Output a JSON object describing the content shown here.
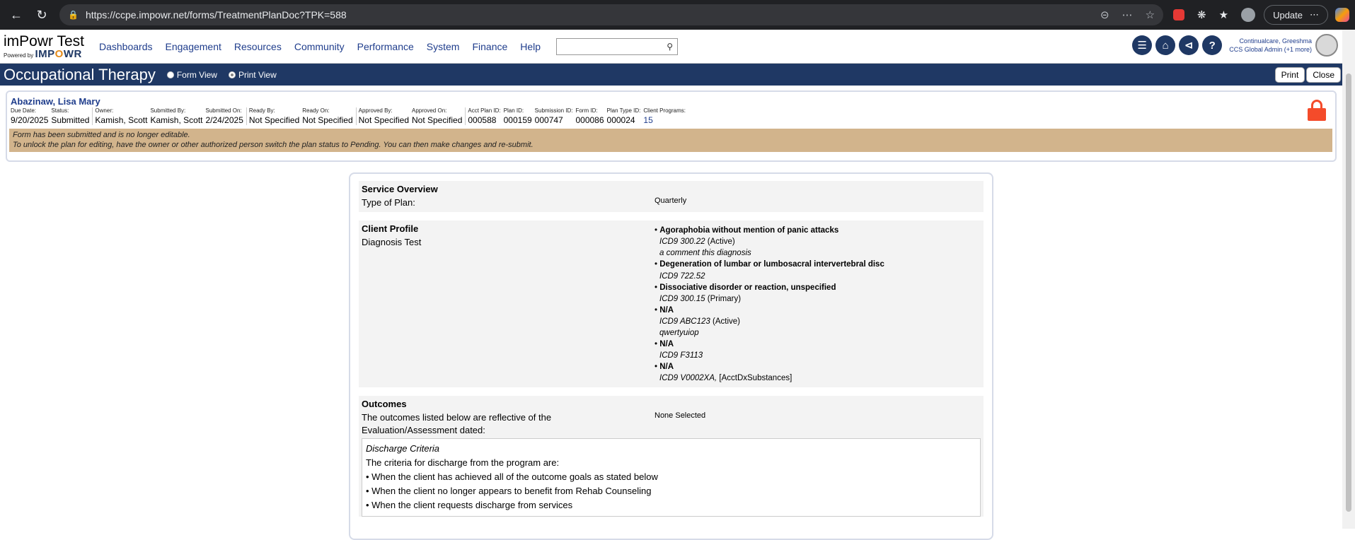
{
  "browser": {
    "url": "https://ccpe.impowr.net/forms/TreatmentPlanDoc?TPK=588",
    "update_label": "Update"
  },
  "app": {
    "logo_title": "imPowr Test",
    "logo_powered": "Powered by",
    "logo_brand_a": "IMP",
    "logo_brand_o": "O",
    "logo_brand_b": "WR",
    "nav": [
      "Dashboards",
      "Engagement",
      "Resources",
      "Community",
      "Performance",
      "System",
      "Finance",
      "Help"
    ],
    "search_placeholder": "",
    "user_line1": "Continualcare, Greeshma",
    "user_line2": "CCS Global Admin (+1 more)"
  },
  "title_bar": {
    "title": "Occupational Therapy",
    "form_view": "Form View",
    "print_view": "Print View",
    "print_btn": "Print",
    "close_btn": "Close"
  },
  "plan": {
    "client_name": "Abazinaw, Lisa Mary",
    "fields": [
      {
        "label": "Due Date:",
        "value": "9/20/2025"
      },
      {
        "label": "Status:",
        "value": "Submitted"
      },
      {
        "label": "Owner:",
        "value": "Kamish, Scott"
      },
      {
        "label": "Submitted By:",
        "value": "Kamish, Scott"
      },
      {
        "label": "Submitted On:",
        "value": "2/24/2025"
      },
      {
        "label": "Ready By:",
        "value": "Not Specified"
      },
      {
        "label": "Ready On:",
        "value": "Not Specified"
      },
      {
        "label": "Approved By:",
        "value": "Not Specified"
      },
      {
        "label": "Approved On:",
        "value": "Not Specified"
      },
      {
        "label": "Acct Plan ID:",
        "value": "000588"
      },
      {
        "label": "Plan ID:",
        "value": "000159"
      },
      {
        "label": "Submission ID:",
        "value": "000747"
      },
      {
        "label": "Form ID:",
        "value": "000086"
      },
      {
        "label": "Plan Type ID:",
        "value": "000024"
      },
      {
        "label": "Client Programs:",
        "value": "15"
      }
    ],
    "notice_line1": "Form has been submitted and is no longer editable.",
    "notice_line2": "To unlock the plan for editing, have the owner or other authorized person switch the plan status to Pending. You can then make changes and re-submit."
  },
  "doc": {
    "service_overview": {
      "title": "Service Overview",
      "type_label": "Type of Plan:",
      "type_value": "Quarterly"
    },
    "client_profile": {
      "title": "Client Profile",
      "label": "Diagnosis Test",
      "diagnoses": [
        {
          "name": "Agoraphobia without mention of panic attacks",
          "code": "ICD9 300.22",
          "suffix": " (Active)",
          "comment": "a comment this diagnosis"
        },
        {
          "name": "Degeneration of lumbar or lumbosacral intervertebral disc",
          "code": "ICD9 722.52",
          "suffix": "",
          "comment": ""
        },
        {
          "name": "Dissociative disorder or reaction, unspecified",
          "code": "ICD9 300.15",
          "suffix": " (Primary)",
          "comment": ""
        },
        {
          "name": "N/A",
          "code": "ICD9 ABC123",
          "suffix": " (Active)",
          "comment": "qwertyuiop"
        },
        {
          "name": "N/A",
          "code": "ICD9 F3113",
          "suffix": "",
          "comment": ""
        },
        {
          "name": "N/A",
          "code": "ICD9 V0002XA,",
          "suffix": " [AcctDxSubstances]",
          "comment": ""
        }
      ]
    },
    "outcomes": {
      "title": "Outcomes",
      "label": "The outcomes listed below are reflective of the Evaluation/Assessment dated:",
      "value": "None Selected",
      "criteria_title": "Discharge Criteria",
      "criteria_intro": "The criteria for discharge from the program are:",
      "criteria": [
        "• When the client has achieved all of the outcome goals as stated below",
        "• When the client no longer appears to benefit from Rehab Counseling",
        "• When the client requests discharge from services"
      ]
    }
  }
}
